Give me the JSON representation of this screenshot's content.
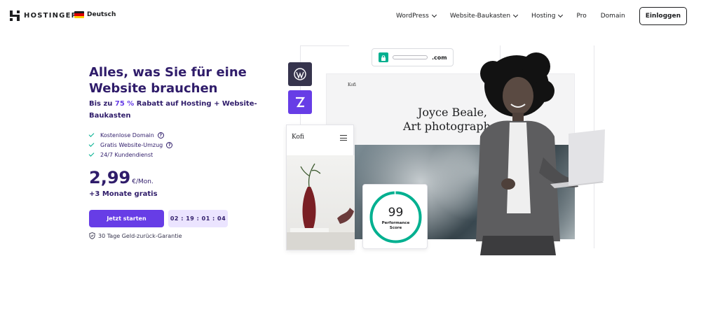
{
  "brand": {
    "name": "HOSTINGER",
    "icon": "hostinger-logo-icon"
  },
  "language": {
    "label": "Deutsch",
    "icon": "german-flag-icon"
  },
  "nav": {
    "items": [
      {
        "label": "WordPress",
        "has_dropdown": true
      },
      {
        "label": "Website-Baukasten",
        "has_dropdown": true
      },
      {
        "label": "Hosting",
        "has_dropdown": true
      },
      {
        "label": "Pro",
        "has_dropdown": false
      },
      {
        "label": "Domain",
        "has_dropdown": false
      }
    ],
    "login_label": "Einloggen"
  },
  "hero": {
    "headline": "Alles, was Sie für eine Website brauchen",
    "subline_prefix": "Bis zu ",
    "subline_accent": "75 %",
    "subline_suffix": " Rabatt auf Hosting + Website-Baukasten",
    "features": [
      {
        "label": "Kostenlose Domain",
        "help": true
      },
      {
        "label": "Gratis Website-Umzug",
        "help": true
      },
      {
        "label": "24/7 Kundendienst",
        "help": false
      }
    ],
    "help_glyph": "?",
    "price": "2,99",
    "price_unit": "€/Mon.",
    "bonus": "+3 Monate gratis",
    "cta_label": "Jetzt starten",
    "timer": "02 : 19 : 01 : 04",
    "guarantee": "30 Tage Geld-zurück-Garantie"
  },
  "illustration": {
    "url_text": ".com",
    "site_brand": "Kofi",
    "site_title_line1": "Joyce Beale,",
    "site_title_line2": "Art photograph",
    "mobile_brand": "Kofi",
    "performance_score": "99",
    "performance_label_line1": "Performance",
    "performance_label_line2": "Score",
    "performance_fraction": 0.99
  },
  "colors": {
    "primary": "#673de6",
    "heading": "#2f1c6a",
    "success": "#00b090",
    "timer_bg": "#ebe4ff"
  }
}
